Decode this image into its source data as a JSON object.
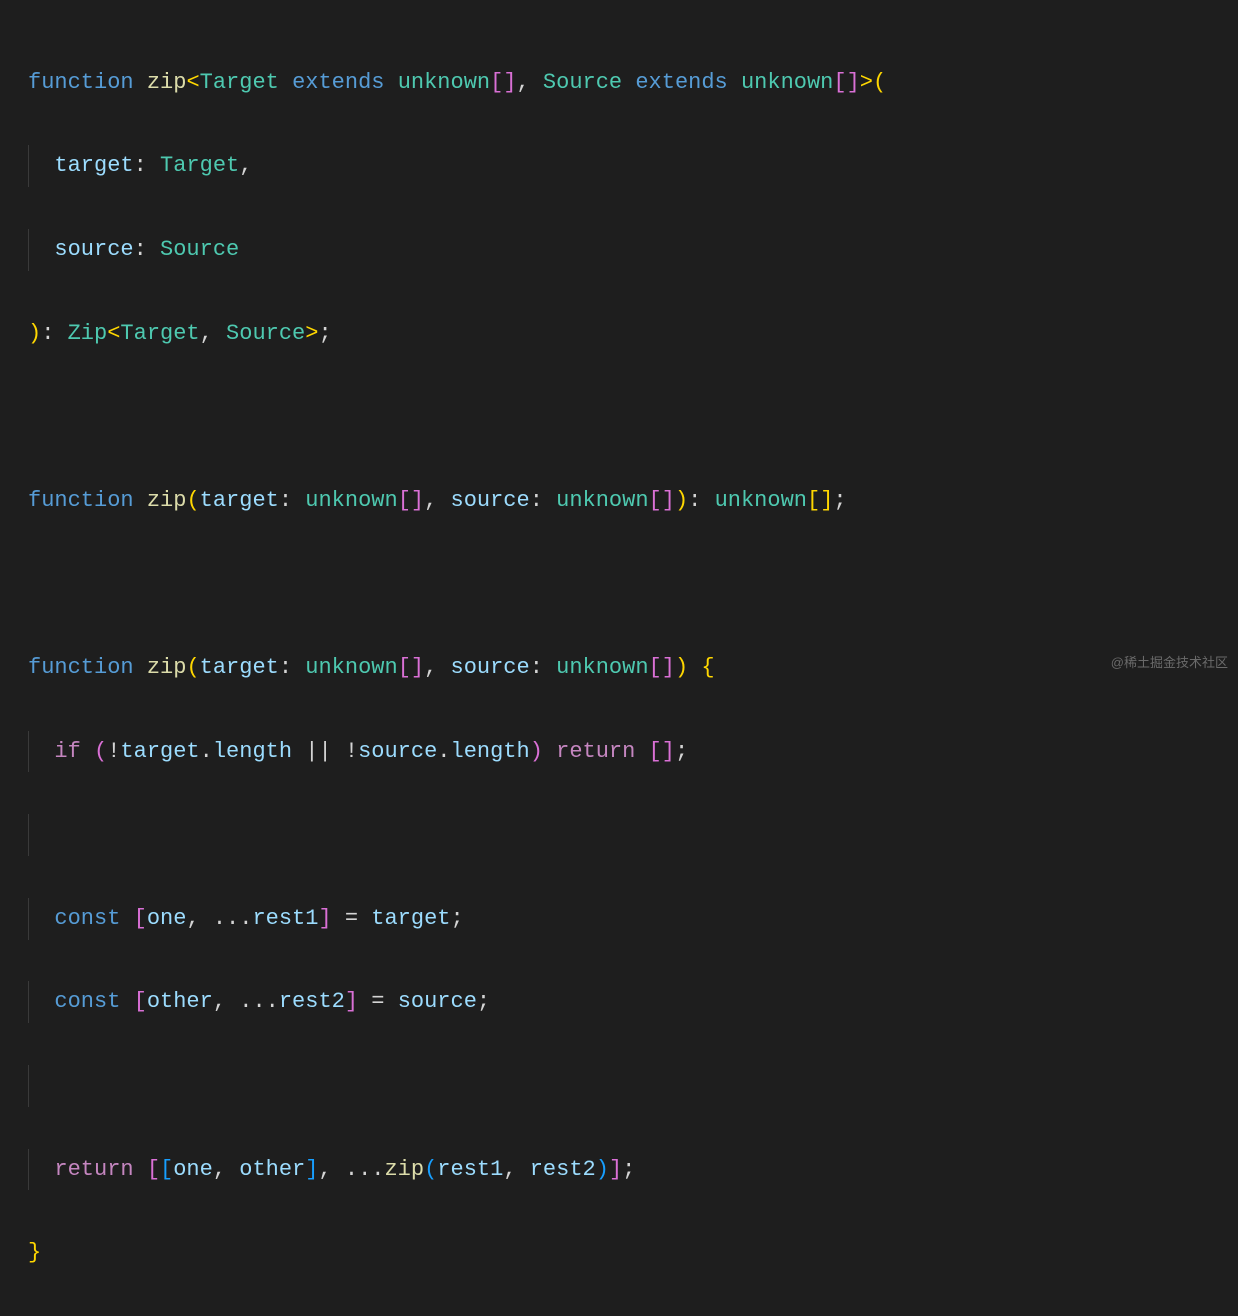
{
  "watermark": "@稀土掘金技术社区",
  "tokens": {
    "function": "function",
    "zip": "zip",
    "Target": "Target",
    "extends": "extends",
    "unknown": "unknown",
    "Source": "Source",
    "target": "target",
    "source": "source",
    "Zip": "Zip",
    "if": "if",
    "length": "length",
    "return": "return",
    "const": "const",
    "one": "one",
    "rest1": "rest1",
    "other": "other",
    "rest2": "rest2",
    "lt": "<",
    "gt": ">",
    "lparen": "(",
    "rparen": ")",
    "lbrack": "[",
    "rbrack": "]",
    "lbrace": "{",
    "rbrace": "}",
    "comma": ",",
    "colon": ":",
    "semi": ";",
    "eq": "=",
    "bang": "!",
    "dot": ".",
    "oror": "||",
    "spread": "...",
    "sp": " ",
    "sp2": "  "
  }
}
